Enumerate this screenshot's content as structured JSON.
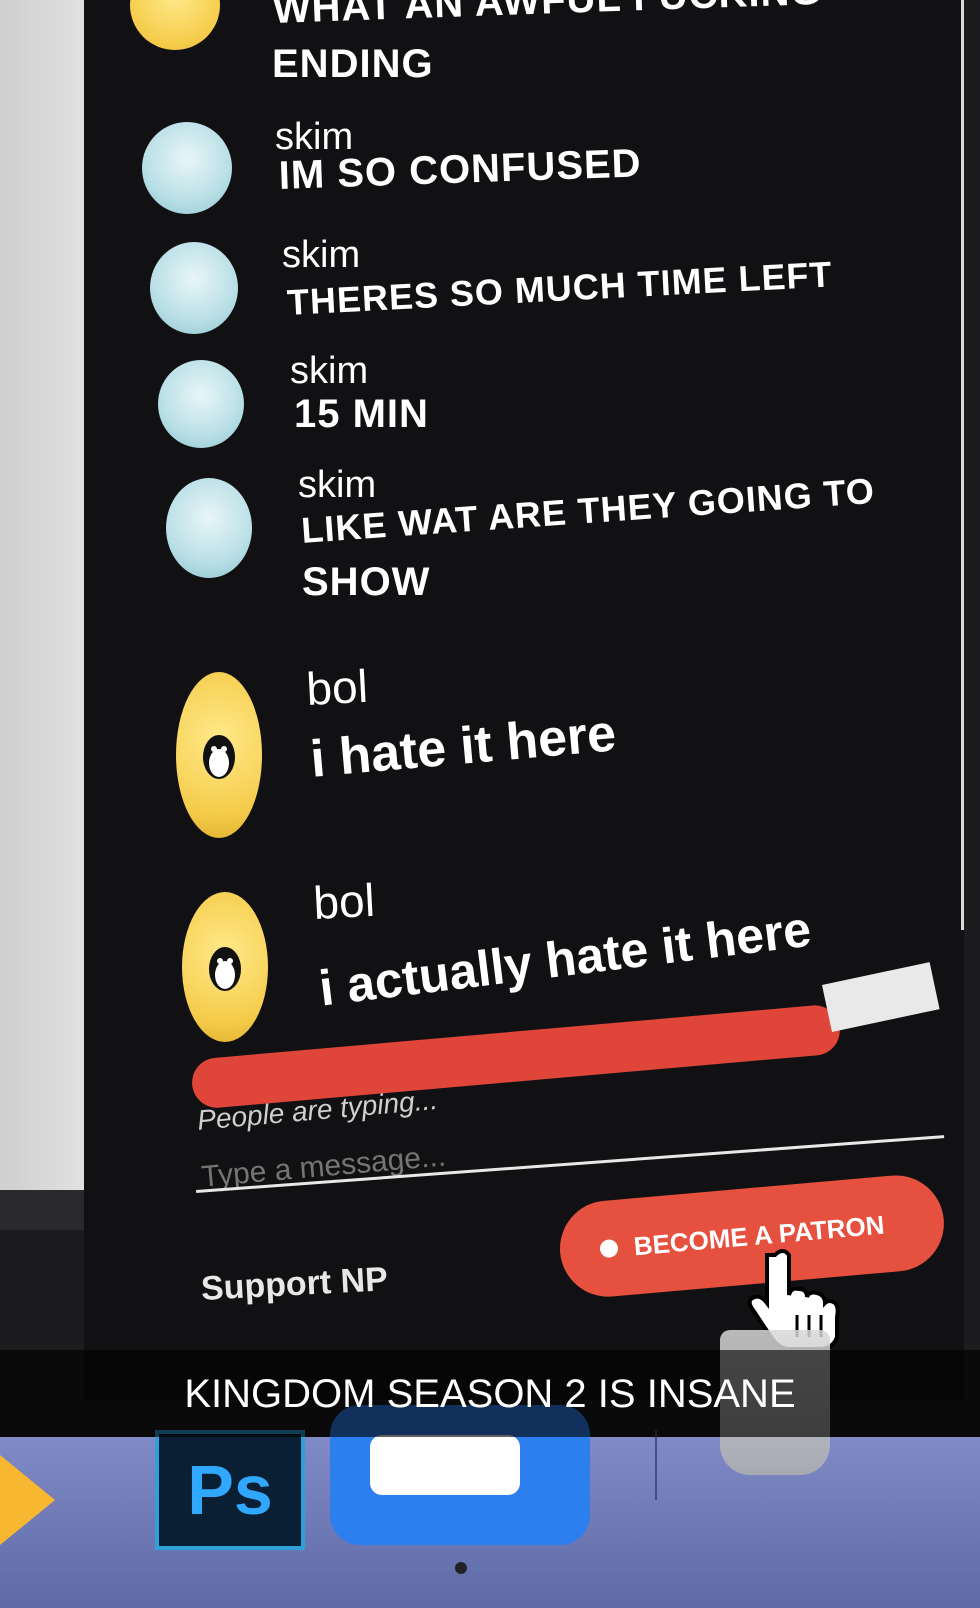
{
  "chat": {
    "partial_message": {
      "text_line1": "WHAT AN AWFUL FUCKING",
      "text_line2": "ENDING"
    },
    "messages": [
      {
        "user": "skim",
        "text": "IM SO CONFUSED"
      },
      {
        "user": "skim",
        "text": "THERES SO MUCH TIME LEFT"
      },
      {
        "user": "skim",
        "text": "15 MIN"
      },
      {
        "user": "skim",
        "text_line1": "LIKE WAT ARE THEY GOING TO",
        "text_line2": "SHOW"
      },
      {
        "user": "bol",
        "text": "i hate it here"
      },
      {
        "user": "bol",
        "text": "i actually hate it here"
      }
    ],
    "typing_status": "People are typing...",
    "input_placeholder": "Type a message...",
    "support_label": "Support NP",
    "patron_button": "BECOME A PATRON"
  },
  "caption": "KINGDOM SEASON 2 IS INSANE",
  "dock": {
    "ps_label": "Ps",
    "icons": [
      "sketch-icon",
      "photoshop-icon",
      "zoom-icon",
      "trash-icon"
    ]
  },
  "colors": {
    "accent": "#e5503f",
    "screen_bg": "#111113",
    "dock": "#6f7ab8"
  }
}
